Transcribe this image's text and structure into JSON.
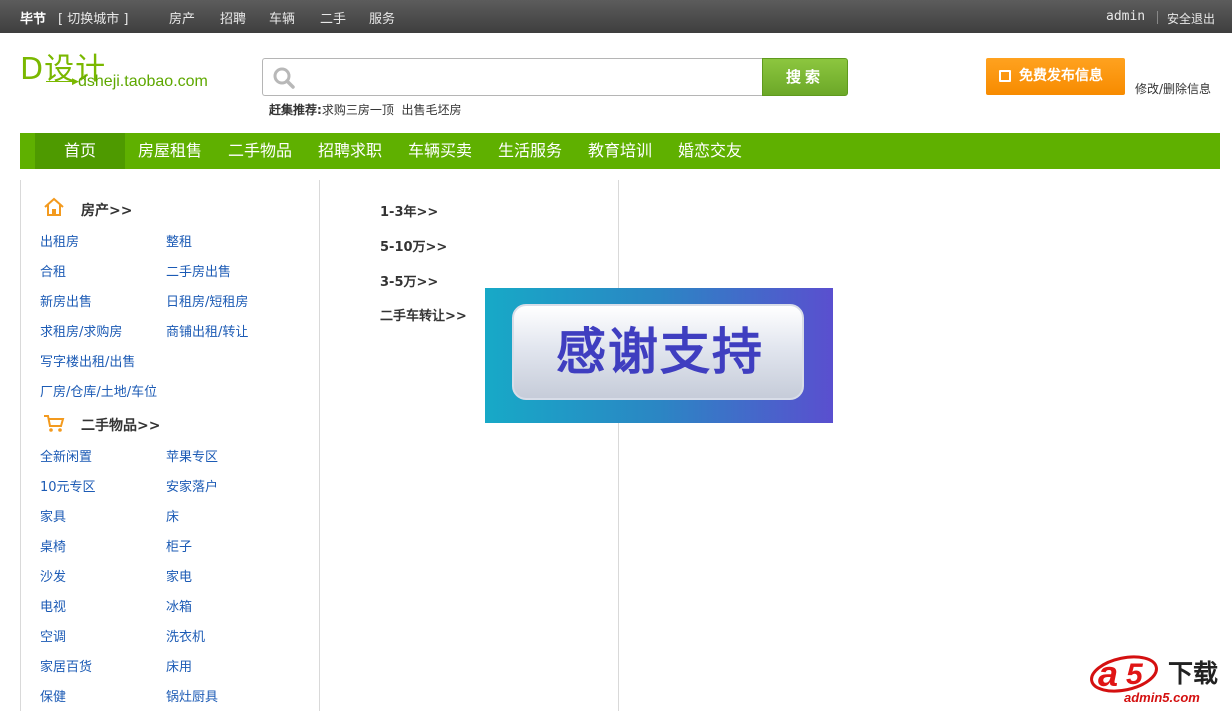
{
  "topbar": {
    "city": "毕节",
    "switch_city": "[ 切换城市 ]",
    "nav": [
      "房产",
      "招聘",
      "车辆",
      "二手",
      "服务"
    ],
    "user": "admin",
    "logout": "安全退出"
  },
  "logo": {
    "title": "D设计",
    "url": "dsheji.taobao.com"
  },
  "search": {
    "placeholder": "",
    "button_label": "搜索",
    "hot_label": "赶集推荐:",
    "hot_items": [
      "求购三房一顶",
      "出售毛坯房"
    ]
  },
  "actions": {
    "publish_label": "免费发布信息",
    "edit_label": "修改/删除信息"
  },
  "mainnav": [
    "首页",
    "房屋租售",
    "二手物品",
    "招聘求职",
    "车辆买卖",
    "生活服务",
    "教育培训",
    "婚恋交友"
  ],
  "left": {
    "sections": [
      {
        "title": "房产>>",
        "icon": "house-icon",
        "links": [
          [
            "出租房",
            "整租"
          ],
          [
            "合租",
            "二手房出售"
          ],
          [
            "新房出售",
            "日租房/短租房"
          ],
          [
            "求租房/求购房",
            "商铺出租/转让"
          ],
          [
            "写字楼出租/出售"
          ],
          [
            "厂房/仓库/土地/车位"
          ]
        ]
      },
      {
        "title": "二手物品>>",
        "icon": "cart-icon",
        "links": [
          [
            "全新闲置",
            "苹果专区"
          ],
          [
            "10元专区",
            "安家落户"
          ],
          [
            "家具",
            "床"
          ],
          [
            "桌椅",
            "柜子"
          ],
          [
            "沙发",
            "家电"
          ],
          [
            "电视",
            "冰箱"
          ],
          [
            "空调",
            "洗衣机"
          ],
          [
            "家居百货",
            "床用"
          ],
          [
            "保健",
            "锅灶厨具"
          ]
        ]
      }
    ]
  },
  "middle": {
    "links": [
      "1-3年>>",
      "5-10万>>",
      "3-5万>>",
      "二手车转让>>"
    ]
  },
  "banner": {
    "text": "感谢支持"
  },
  "watermark": {
    "download": "下载",
    "site": "admin5.com"
  },
  "colors": {
    "nav_green": "#5fb000",
    "search_green": "#7ab800",
    "publish_orange": "#f78b00",
    "link_blue": "#1c5bb5",
    "topbar": "#4a4a4a"
  }
}
